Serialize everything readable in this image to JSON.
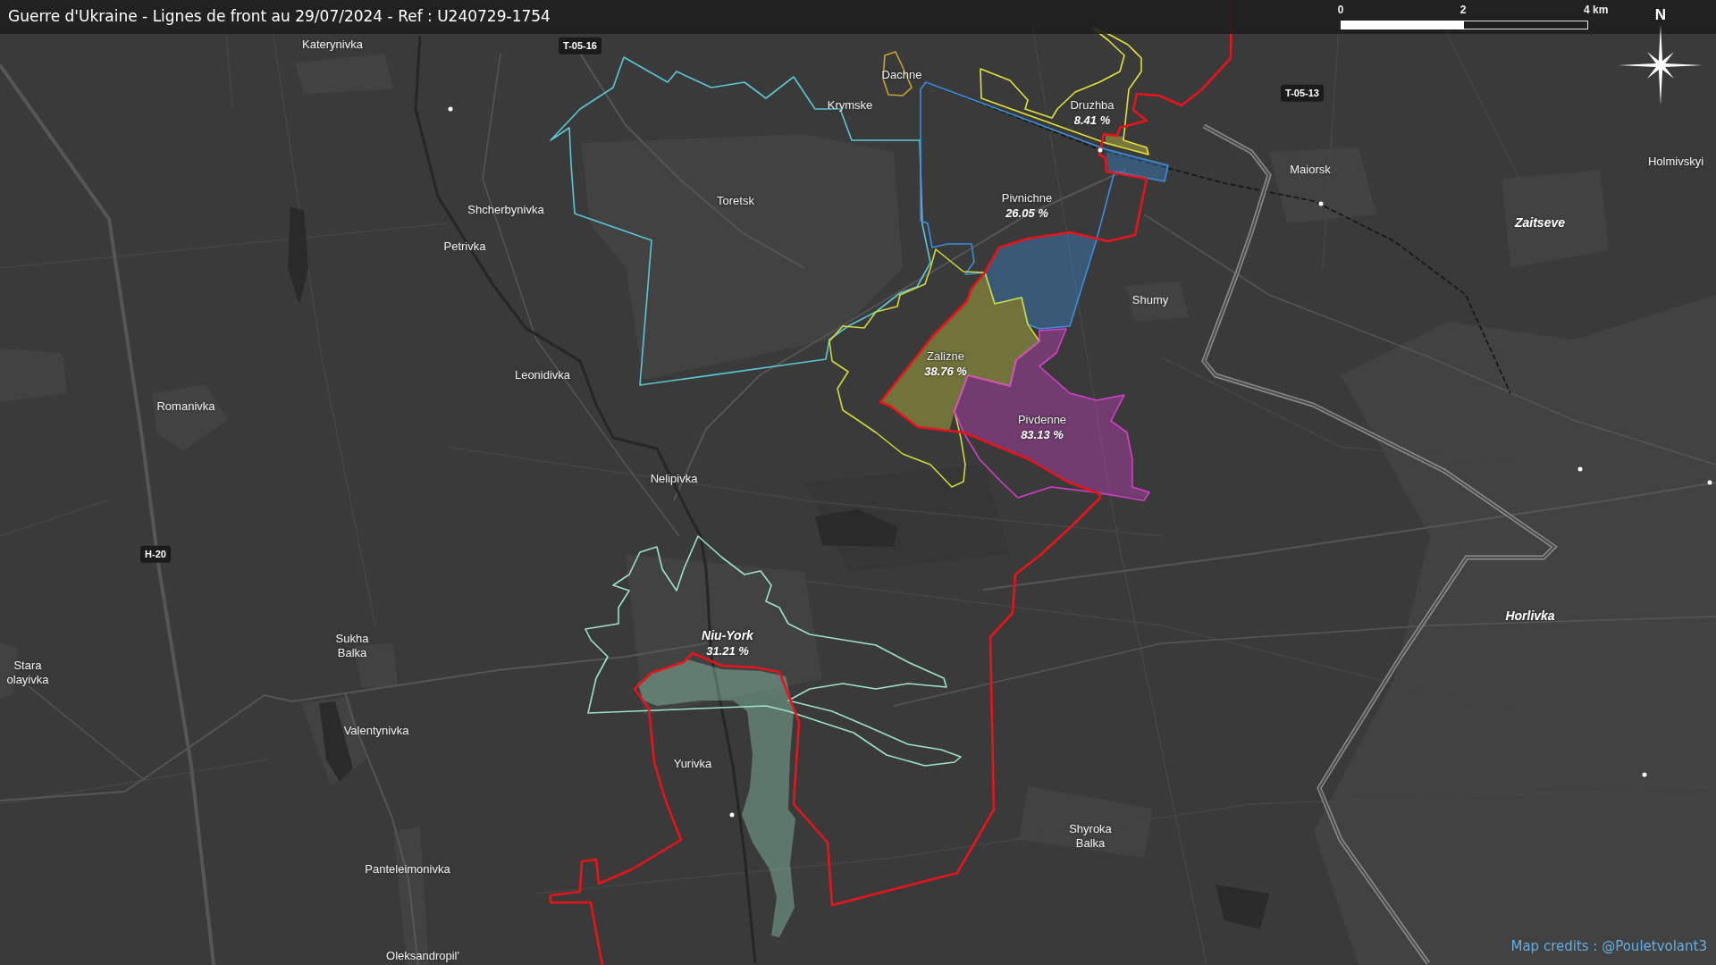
{
  "title_bar": {
    "title": "Guerre d'Ukraine - Lignes de front au 29/07/2024 - Ref : U240729-1754",
    "scale_bar": {
      "labels": [
        "0",
        "2",
        "4 km"
      ]
    },
    "compass": {
      "label": "N"
    }
  },
  "map": {
    "road_signs": [
      "T-05-16",
      "T-05-13",
      "H-20"
    ],
    "places": [
      {
        "name": "Katerynivka",
        "kind": "village"
      },
      {
        "name": "Krymske",
        "kind": "village"
      },
      {
        "name": "Maiorsk",
        "kind": "village"
      },
      {
        "name": "Holmivskyi",
        "kind": "village"
      },
      {
        "name": "Shcherbynivka",
        "kind": "village"
      },
      {
        "name": "Zaitseve",
        "kind": "city"
      },
      {
        "name": "Petrivka",
        "kind": "village"
      },
      {
        "name": "Shumy",
        "kind": "village"
      },
      {
        "name": "Leonidivka",
        "kind": "village"
      },
      {
        "name": "Romanivka",
        "kind": "village"
      },
      {
        "name": "Nelipivka",
        "kind": "village"
      },
      {
        "name": "Horlivka",
        "kind": "city"
      },
      {
        "name": "Sukha Balka",
        "kind": "village"
      },
      {
        "name": "Stara olayivka",
        "kind": "village"
      },
      {
        "name": "Valentynivka",
        "kind": "village"
      },
      {
        "name": "Yurivka",
        "kind": "village"
      },
      {
        "name": "Shyroka Balka",
        "kind": "village"
      },
      {
        "name": "Panteleimonivka",
        "kind": "village"
      },
      {
        "name": "Oleksandropil'",
        "kind": "village"
      }
    ],
    "areas": [
      {
        "name": "Dachne",
        "kind": "village",
        "color": "#c9a23a"
      },
      {
        "name": "Druzhba",
        "kind": "village",
        "share": "8.41 %",
        "color": "#e3e23c"
      },
      {
        "name": "Toretsk",
        "kind": "village",
        "color": "#5cc6d6"
      },
      {
        "name": "Pivnichne",
        "kind": "village",
        "share": "26.05 %",
        "color": "#3b8fe0"
      },
      {
        "name": "Zalizne",
        "kind": "village",
        "share": "38.76 %",
        "color": "#d2d83a"
      },
      {
        "name": "Pivdenne",
        "kind": "village",
        "share": "83.13 %",
        "color": "#d63fcf"
      },
      {
        "name": "Niu-York",
        "kind": "city",
        "share": "31.21 %",
        "color": "#9de3c4"
      }
    ]
  },
  "credits": "Map credits : @Pouletvolant3"
}
